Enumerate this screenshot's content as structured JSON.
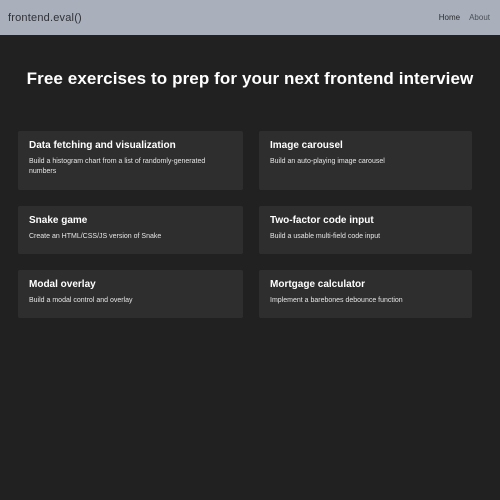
{
  "nav": {
    "brand": "frontend.eval()",
    "links": [
      {
        "label": "Home",
        "active": true
      },
      {
        "label": "About",
        "active": false
      }
    ]
  },
  "hero": {
    "title": "Free exercises to prep for your next frontend interview"
  },
  "exercises": [
    {
      "title": "Data fetching and visualization",
      "description": "Build a histogram chart from a list of randomly-generated numbers"
    },
    {
      "title": "Image carousel",
      "description": "Build an auto-playing image carousel"
    },
    {
      "title": "Snake game",
      "description": "Create an HTML/CSS/JS version of Snake"
    },
    {
      "title": "Two-factor code input",
      "description": "Build a usable multi-field code input"
    },
    {
      "title": "Modal overlay",
      "description": "Build a modal control and overlay"
    },
    {
      "title": "Mortgage calculator",
      "description": "Implement a barebones debounce function"
    }
  ],
  "colors": {
    "navbar": "#a9b0bb",
    "background": "#212121",
    "card": "#2e2e2e"
  }
}
